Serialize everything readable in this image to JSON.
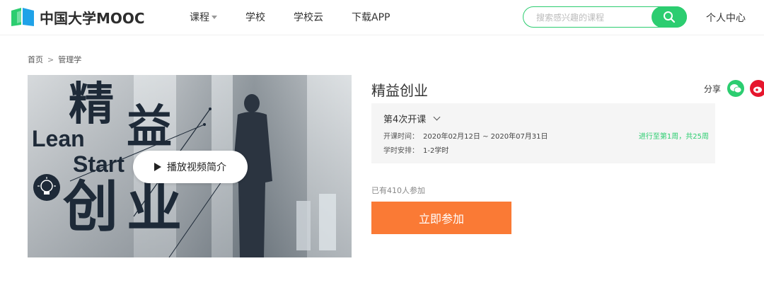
{
  "header": {
    "logo_text": "中国大学MOOC",
    "nav": [
      {
        "label": "课程",
        "has_dropdown": true
      },
      {
        "label": "学校",
        "has_dropdown": false
      },
      {
        "label": "学校云",
        "has_dropdown": false
      },
      {
        "label": "下载APP",
        "has_dropdown": false
      }
    ],
    "search": {
      "placeholder": "搜索感兴趣的课程",
      "value": ""
    },
    "user_center": "个人中心"
  },
  "breadcrumb": {
    "home": "首页",
    "separator": ">",
    "category": "管理学"
  },
  "cover": {
    "title_chars": [
      "精",
      "益",
      "创",
      "业"
    ],
    "overlay_lines": [
      "Lean",
      "Start"
    ],
    "play_label": "播放视频简介"
  },
  "course": {
    "title": "精益创业",
    "share_label": "分享",
    "share_icons": [
      "wechat-icon",
      "weibo-icon"
    ],
    "term_label": "第4次开课",
    "schedule_label": "开课时间：",
    "schedule_value": "2020年02月12日 ~ 2020年07月31日",
    "hours_label": "学时安排：",
    "hours_value": "1-2学时",
    "progress_text": "进行至第1周，共25周",
    "enrolled": "已有410人参加",
    "join_label": "立即参加"
  },
  "colors": {
    "brand_green": "#2ccd70",
    "join_orange": "#fa7a35",
    "wechat_green": "#2ccd70",
    "weibo_red": "#e6162d"
  }
}
